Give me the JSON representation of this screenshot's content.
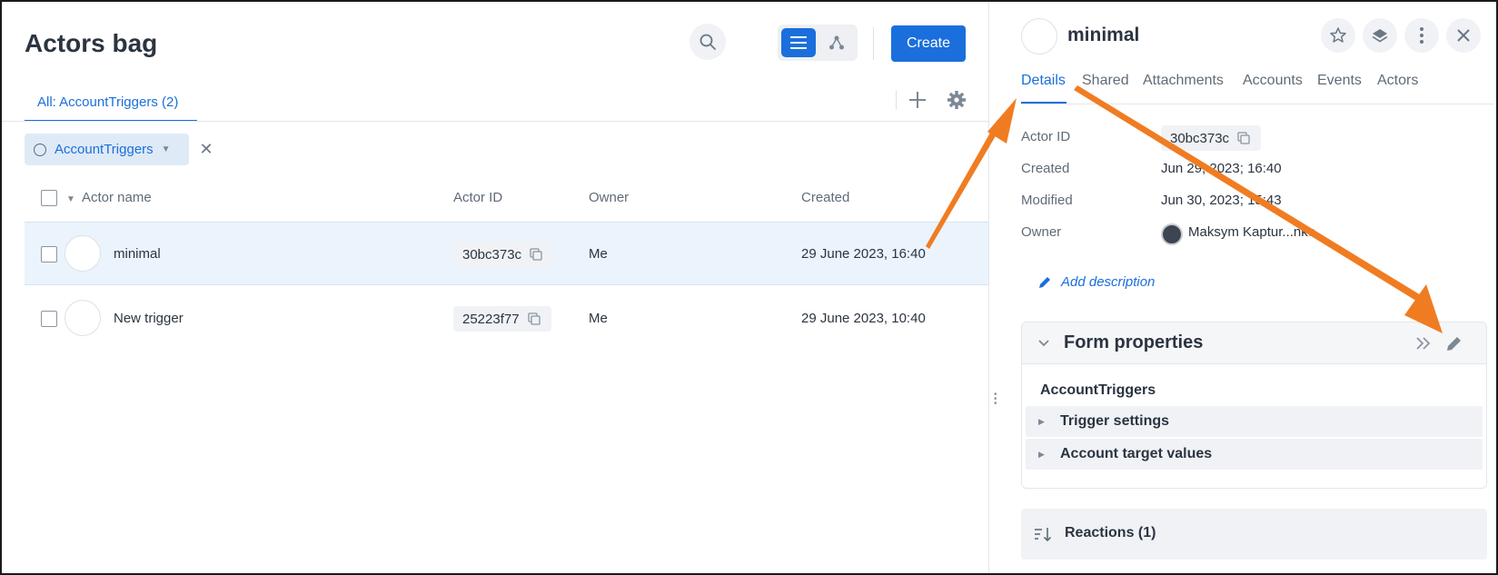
{
  "list": {
    "title": "Actors bag",
    "create_label": "Create",
    "tab_label": "All: AccountTriggers (2)",
    "filter_chip": "AccountTriggers",
    "columns": [
      "Actor name",
      "Actor ID",
      "Owner",
      "Created"
    ],
    "rows": [
      {
        "name": "minimal",
        "id": "30bc373c",
        "owner": "Me",
        "created": "29 June 2023, 16:40"
      },
      {
        "name": "New trigger",
        "id": "25223f77",
        "owner": "Me",
        "created": "29 June 2023, 10:40"
      }
    ]
  },
  "details": {
    "title": "minimal",
    "tabs": [
      "Details",
      "Shared",
      "Attachments",
      "Accounts",
      "Events",
      "Actors"
    ],
    "fields": {
      "actor_id_label": "Actor ID",
      "actor_id_value": "30bc373c",
      "created_label": "Created",
      "created_value": "Jun 29, 2023; 16:40",
      "modified_label": "Modified",
      "modified_value": "Jun 30, 2023; 15:43",
      "owner_label": "Owner",
      "owner_value": "Maksym Kaptur...nko"
    },
    "add_description": "Add description",
    "form": {
      "title": "Form properties",
      "name": "AccountTriggers",
      "sections": [
        "Trigger settings",
        "Account target values"
      ]
    },
    "reactions_label": "Reactions (1)"
  },
  "colors": {
    "accent": "#1a6fdc",
    "selected_row": "#ebf3fc",
    "annotation_arrow": "#f07c22"
  },
  "icons": [
    "search-icon",
    "list-view-icon",
    "graph-view-icon",
    "plus-icon",
    "gear-icon",
    "close-icon",
    "copy-icon",
    "star-icon",
    "layers-icon",
    "kebab-menu-icon",
    "pencil-icon",
    "chevron-down-icon",
    "double-chevron-right-icon",
    "sort-icon"
  ]
}
